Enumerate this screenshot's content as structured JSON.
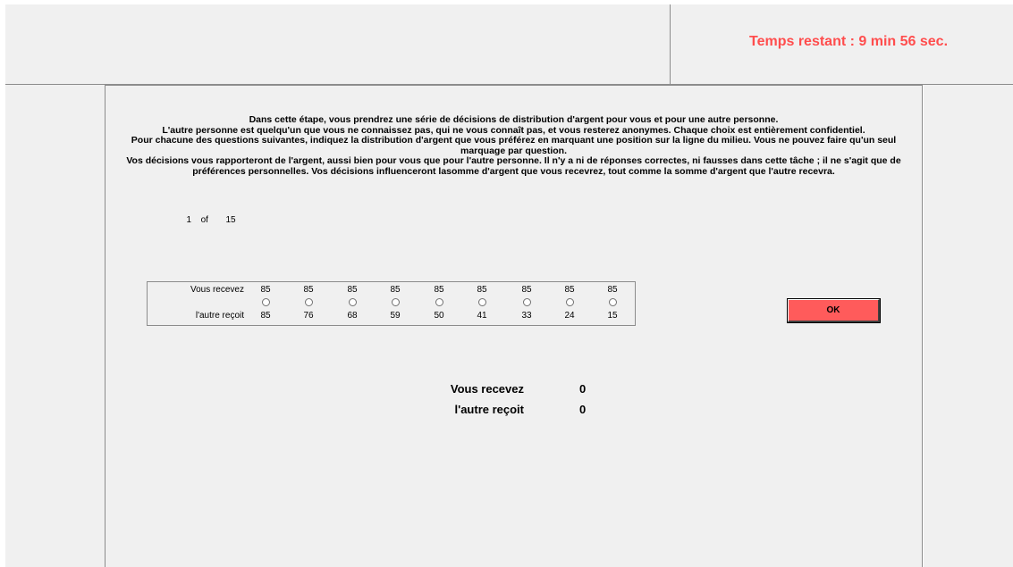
{
  "timer": {
    "text": "Temps restant : 9 min 56 sec."
  },
  "instructions": [
    "Dans cette étape, vous prendrez une série de décisions de distribution d'argent pour vous et pour une autre personne.",
    "L'autre personne est quelqu'un que vous ne connaissez pas, qui ne vous connaît pas, et vous resterez anonymes. Chaque choix est entièrement confidentiel.",
    "Pour chacune des questions suivantes, indiquez la distribution d'argent que vous préférez en marquant une position sur la ligne du milieu. Vous ne pouvez faire qu'un seul marquage par question.",
    "Vos décisions vous rapporteront de l'argent, aussi bien pour vous que pour l'autre personne. Il n'y a ni de réponses correctes, ni fausses dans cette tâche ; il ne s'agit que de préférences personnelles. Vos décisions influenceront lasomme d'argent que vous recevrez, tout comme la somme d'argent que l'autre recevra."
  ],
  "counter": {
    "current": "1",
    "of": "of",
    "total": "15"
  },
  "choice": {
    "self_label": "Vous recevez",
    "other_label": "l'autre reçoit",
    "self_values": [
      "85",
      "85",
      "85",
      "85",
      "85",
      "85",
      "85",
      "85",
      "85"
    ],
    "other_values": [
      "85",
      "76",
      "68",
      "59",
      "50",
      "41",
      "33",
      "24",
      "15"
    ],
    "selected_index": null
  },
  "ok_button": {
    "label": "OK",
    "color": "#ff5b5b"
  },
  "summary": {
    "self_label": "Vous recevez",
    "self_value": "0",
    "other_label": "l'autre reçoit",
    "other_value": "0"
  },
  "colors": {
    "timer": "#ff4d4d",
    "background": "#f0f0f0",
    "border": "#8c8c8c"
  }
}
